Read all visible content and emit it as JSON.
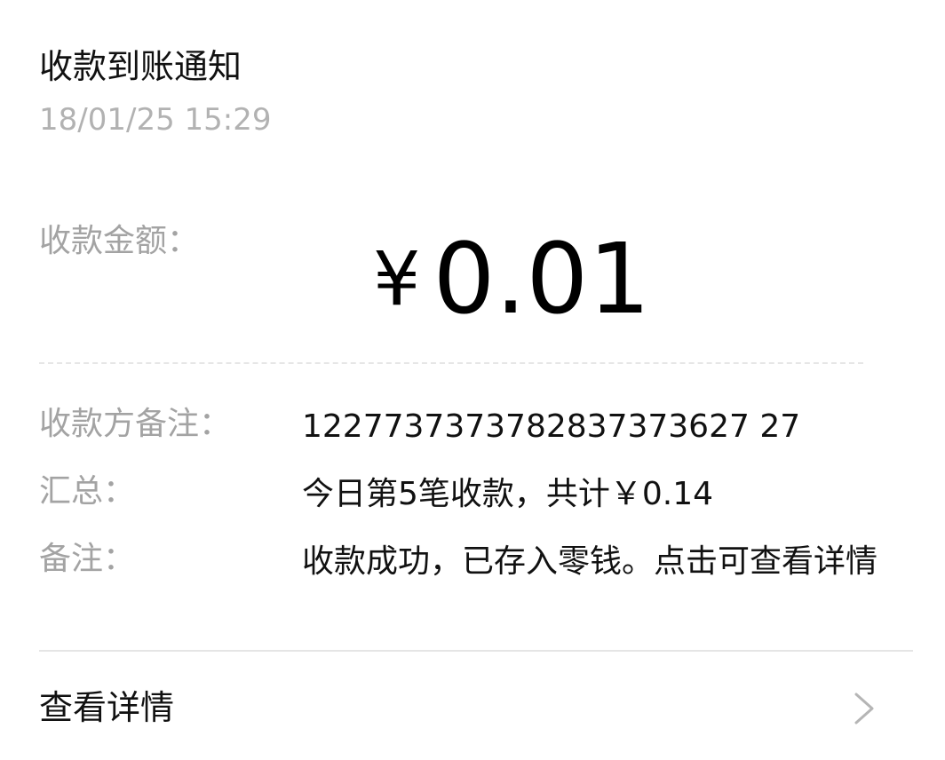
{
  "notification": {
    "title": "收款到账通知",
    "timestamp": "18/01/25 15:29"
  },
  "amount": {
    "label": "收款金额：",
    "currency": "¥",
    "value": "0.01"
  },
  "details": {
    "payee_note_label": "收款方备注：",
    "payee_note_value": "1227737373782837373627 27",
    "summary_label": "汇总：",
    "summary_value": "今日第5笔收款，共计￥0.14",
    "remark_label": "备注：",
    "remark_value": "收款成功，已存入零钱。点击可查看详情"
  },
  "link": {
    "label": "查看详情",
    "icon": "chevron-right-icon"
  },
  "colors": {
    "label_gray": "#a3a3a3",
    "timestamp_gray": "#b2b2b2",
    "text_dark": "#111111",
    "divider": "#e5e5e5",
    "chevron": "#b5b5b5"
  }
}
